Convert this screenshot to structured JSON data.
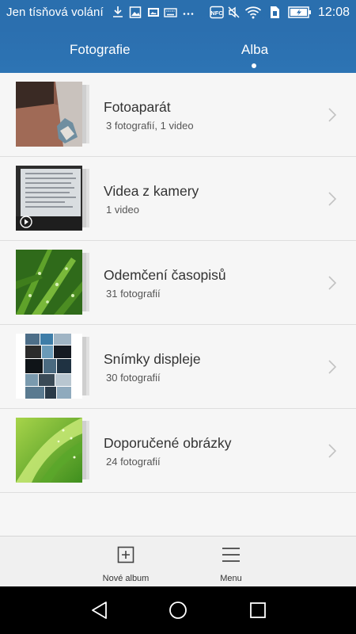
{
  "status_bar": {
    "carrier": "Jen tísňová volání",
    "time": "12:08",
    "icons": [
      "download-icon",
      "image-icon",
      "photo-icon",
      "keyboard-icon",
      "more-icon",
      "nfc-icon",
      "mute-icon",
      "wifi-icon",
      "sim-icon",
      "battery-icon"
    ]
  },
  "tabs": [
    {
      "label": "Fotografie",
      "active": false
    },
    {
      "label": "Alba",
      "active": true
    }
  ],
  "albums": [
    {
      "title": "Fotoaparát",
      "subtitle": "3 fotografií,  1 video"
    },
    {
      "title": "Videa z kamery",
      "subtitle": "1 video"
    },
    {
      "title": "Odemčení časopisů",
      "subtitle": "31 fotografií"
    },
    {
      "title": "Snímky displeje",
      "subtitle": "30 fotografií"
    },
    {
      "title": "Doporučené obrázky",
      "subtitle": "24 fotografií"
    }
  ],
  "toolbar": {
    "new_album_label": "Nové album",
    "menu_label": "Menu"
  },
  "colors": {
    "header": "#2b6faf",
    "background": "#f6f6f6",
    "toolbar": "#f0f0f0",
    "navbar": "#000000"
  }
}
